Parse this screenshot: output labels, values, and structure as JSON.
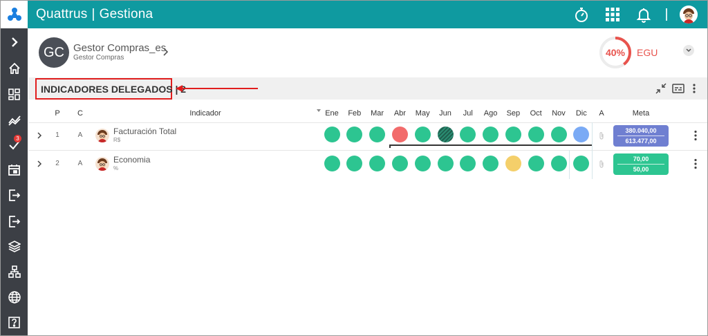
{
  "app": {
    "name": "Quattrus",
    "separator": "|",
    "module": "Gestiona"
  },
  "topbar": {
    "icons": [
      "stopwatch-icon",
      "apps-grid-icon",
      "bell-icon",
      "user-avatar-icon"
    ]
  },
  "sidebar": {
    "items": [
      "expand-icon",
      "home-icon",
      "dashboard-icon",
      "trend-icon",
      "tasks-icon",
      "calendar-icon",
      "login-icon",
      "logout-icon",
      "layers-icon",
      "structure-icon",
      "globe-icon",
      "help-icon"
    ],
    "tasks_badge": "3"
  },
  "user": {
    "initials": "GC",
    "name": "Gestor Compras_es",
    "role": "Gestor Compras"
  },
  "progress": {
    "value": 0.4,
    "label": "40%",
    "unit": "EGU"
  },
  "colors": {
    "brand": "#0f9aa0",
    "green": "#2dc591",
    "red": "#f26b6b",
    "yellow": "#f4cf6a",
    "blue": "#7aaaf5",
    "meta_blue": "#6f7fd1",
    "meta_green": "#2dc591",
    "progress": "#e8534d"
  },
  "section": {
    "title": "INDICADORES DELEGADOS | 2"
  },
  "table": {
    "headers": {
      "p": "P",
      "c": "C",
      "indicator": "Indicador",
      "a": "A",
      "meta": "Meta"
    },
    "months": [
      "Ene",
      "Feb",
      "Mar",
      "Abr",
      "May",
      "Jun",
      "Jul",
      "Ago",
      "Sep",
      "Oct",
      "Nov",
      "Dic"
    ],
    "rows": [
      {
        "p": "1",
        "c": "A",
        "name": "Facturación Total",
        "unit": "R$",
        "status": [
          "green",
          "green",
          "green",
          "red",
          "green",
          "striped",
          "green",
          "green",
          "green",
          "green",
          "green",
          "blue"
        ],
        "meta_top": "380.040,00",
        "meta_bottom": "613.477,00",
        "meta_color": "blue"
      },
      {
        "p": "2",
        "c": "A",
        "name": "Economia",
        "unit": "%",
        "status": [
          "green",
          "green",
          "green",
          "green",
          "green",
          "green",
          "green",
          "green",
          "yellow",
          "green",
          "green",
          "green"
        ],
        "meta_top": "70,00",
        "meta_bottom": "50,00",
        "meta_color": "green"
      }
    ]
  }
}
